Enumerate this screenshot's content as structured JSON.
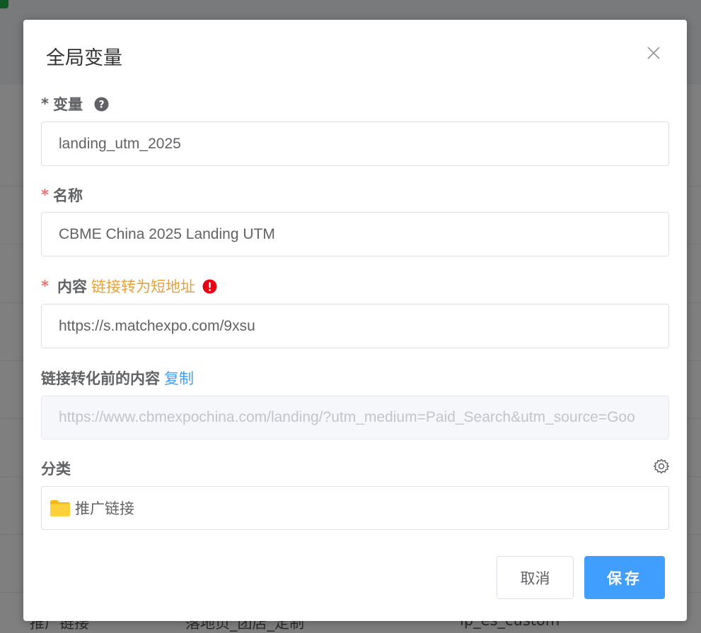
{
  "background": {
    "row_cells": [
      "推广链接",
      "落地页_团店_定制",
      "lp_es_custom"
    ]
  },
  "dialog": {
    "title": "全局变量",
    "close_icon": "close-icon",
    "fields": {
      "variable": {
        "required_mark": "*",
        "label": "变量",
        "help_icon": "question-circle-icon",
        "value": "landing_utm_2025"
      },
      "name": {
        "required_mark": "*",
        "label": "名称",
        "value": "CBME China 2025 Landing UTM"
      },
      "content": {
        "required_mark": "*",
        "label": "内容",
        "link_text": "链接转为短地址",
        "warning_icon": "exclamation-circle-icon",
        "value": "https://s.matchexpo.com/9xsu"
      },
      "original": {
        "label": "链接转化前的内容",
        "copy_link": "复制",
        "value": "https://www.cbmexpochina.com/landing/?utm_medium=Paid_Search&utm_source=Goo"
      },
      "category": {
        "label": "分类",
        "settings_icon": "gear-icon",
        "folder_icon": "folder-icon",
        "value": "推广链接"
      }
    },
    "buttons": {
      "cancel": "取消",
      "save": "保存"
    }
  },
  "colors": {
    "primary": "#409eff",
    "warning_link": "#e6a23c",
    "required": "#f56c6c",
    "error_icon": "#e60012"
  }
}
